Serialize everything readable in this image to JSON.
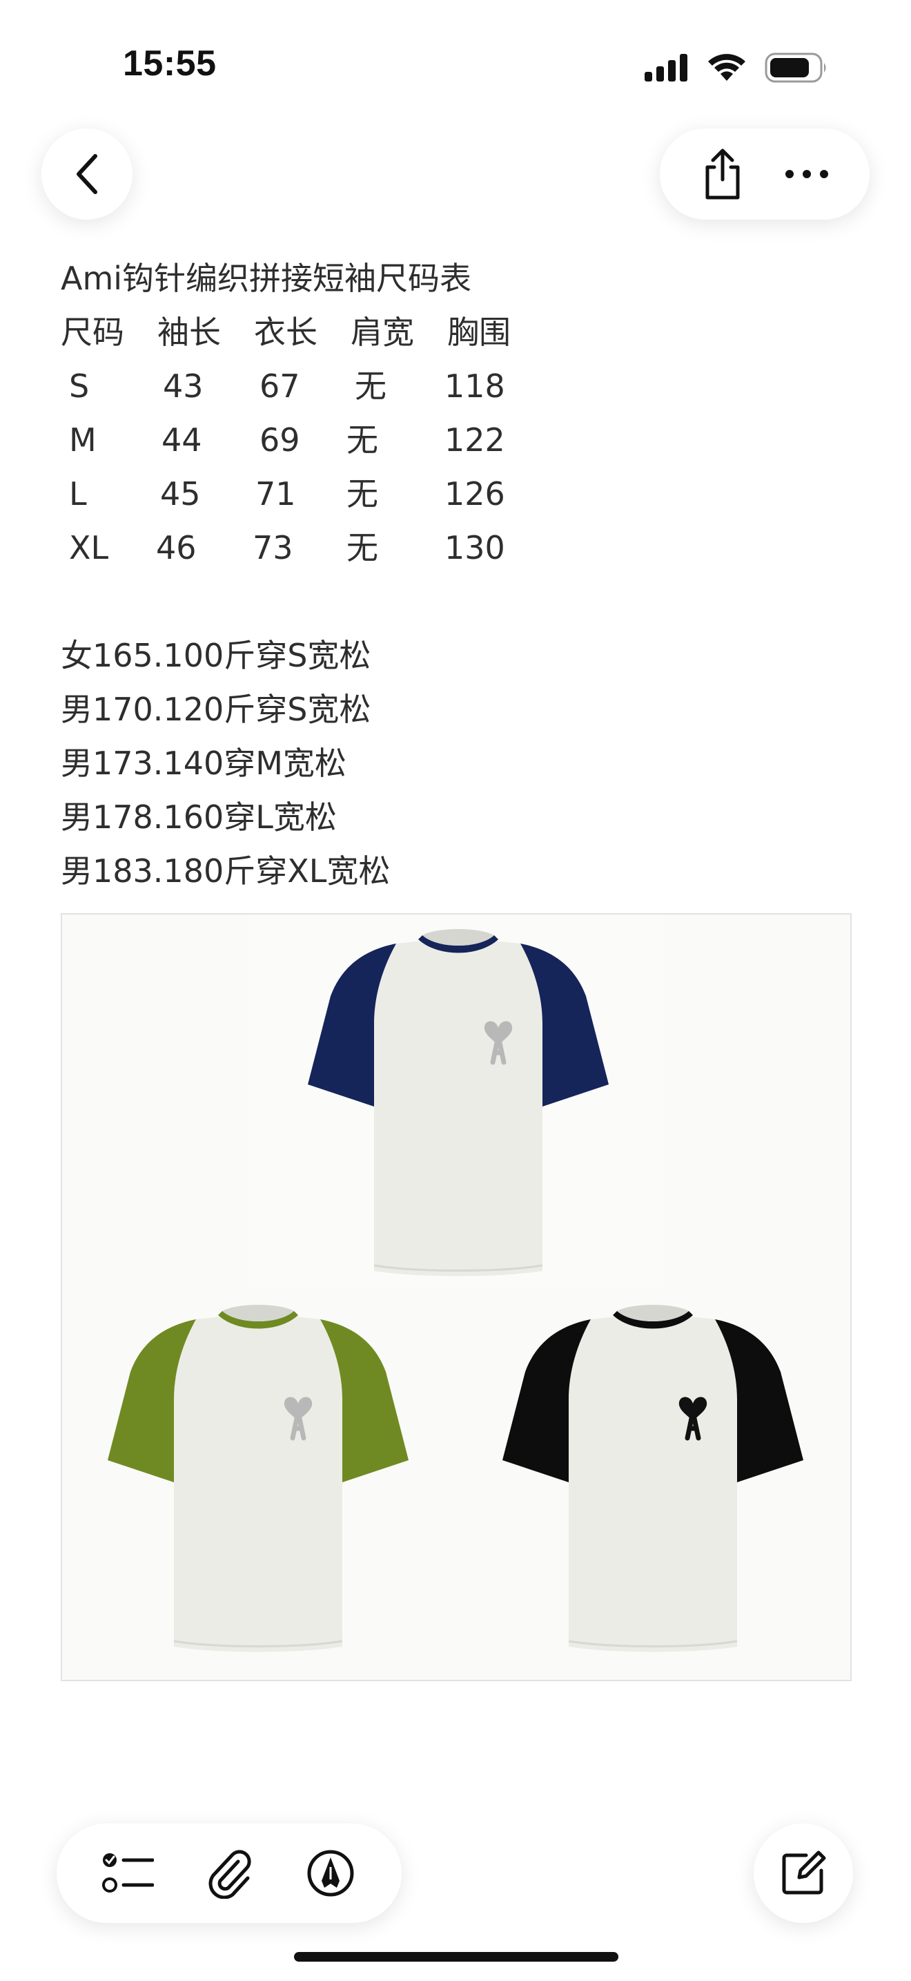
{
  "status_bar": {
    "time": "15:55",
    "icons": [
      "cellular-signal-icon",
      "wifi-icon",
      "battery-icon"
    ]
  },
  "nav": {
    "back_icon": "chevron-left-icon",
    "share_icon": "share-icon",
    "more_icon": "more-icon"
  },
  "note": {
    "title": "Ami钩针编织拼接短袖尺码表",
    "size_table": {
      "headers": [
        "尺码",
        "袖长",
        "衣长",
        "肩宽",
        "胸围"
      ],
      "rows": [
        [
          "S",
          "43",
          "67",
          "无",
          "118"
        ],
        [
          "M",
          "44",
          "69",
          "无",
          "122"
        ],
        [
          "L",
          "45",
          "71",
          "无",
          "126"
        ],
        [
          "XL",
          "46",
          "73",
          "无",
          "130"
        ]
      ]
    },
    "recommendations": [
      "女165.100斤穿S宽松",
      "男170.120斤穿S宽松",
      "男173.140穿M宽松",
      "男178.160穿L宽松",
      "男183.180斤穿XL宽松"
    ]
  },
  "photo": {
    "shirts": [
      {
        "sleeve_color": "#15255a",
        "logo_color": "#b8b8b8"
      },
      {
        "sleeve_color": "#6f8a22",
        "logo_color": "#b8b8b8"
      },
      {
        "sleeve_color": "#0d0d0d",
        "logo_color": "#111111"
      }
    ],
    "body_color": "#ecece6"
  },
  "toolbar": {
    "icons": [
      "checklist-icon",
      "paperclip-icon",
      "markup-pen-icon",
      "compose-icon"
    ]
  }
}
